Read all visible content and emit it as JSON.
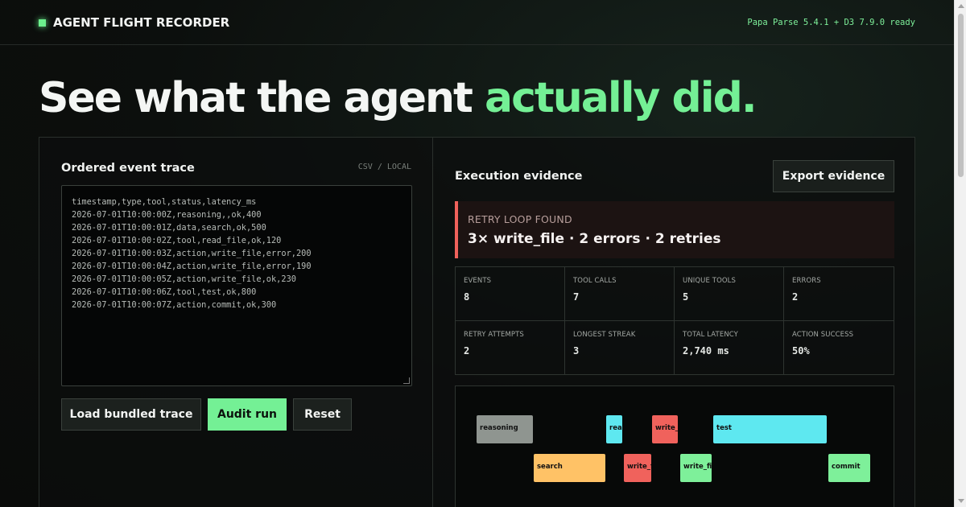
{
  "header": {
    "title": "AGENT FLIGHT RECORDER",
    "status": "Papa Parse 5.4.1 + D3 7.9.0 ready",
    "logo_icon": "square-icon"
  },
  "hero": {
    "lead": "See what the agent ",
    "accent": "actually did."
  },
  "colors": {
    "accent": "#74f095",
    "error": "#f0625c",
    "reasoning": "#8f9590",
    "data": "#ffc266",
    "tool": "#5ee8f0",
    "action": "#7ef09a"
  },
  "trace_panel": {
    "title": "Ordered event trace",
    "tag": "CSV / LOCAL",
    "lines": [
      "timestamp,type,tool,status,latency_ms",
      "2026-07-01T10:00:00Z,reasoning,,ok,400",
      "2026-07-01T10:00:01Z,data,search,ok,500",
      "2026-07-01T10:00:02Z,tool,read_file,ok,120",
      "2026-07-01T10:00:03Z,action,write_file,error,200",
      "2026-07-01T10:00:04Z,action,write_file,error,190",
      "2026-07-01T10:00:05Z,action,write_file,ok,230",
      "2026-07-01T10:00:06Z,tool,test,ok,800",
      "2026-07-01T10:00:07Z,action,commit,ok,300"
    ],
    "buttons": {
      "load": "Load bundled trace",
      "audit": "Audit run",
      "reset": "Reset"
    }
  },
  "evidence_panel": {
    "title": "Execution evidence",
    "export_label": "Export evidence",
    "alert": {
      "label": "RETRY LOOP FOUND",
      "value": "3× write_file · 2 errors · 2 retries"
    },
    "stats": [
      {
        "label": "EVENTS",
        "value": "8"
      },
      {
        "label": "TOOL CALLS",
        "value": "7"
      },
      {
        "label": "UNIQUE TOOLS",
        "value": "5"
      },
      {
        "label": "ERRORS",
        "value": "2"
      },
      {
        "label": "RETRY ATTEMPTS",
        "value": "2"
      },
      {
        "label": "LONGEST STREAK",
        "value": "3"
      },
      {
        "label": "TOTAL LATENCY",
        "value": "2,740 ms"
      },
      {
        "label": "ACTION SUCCESS",
        "value": "50%"
      }
    ],
    "timeline": [
      {
        "label": "reasoning",
        "type": "reasoning"
      },
      {
        "label": "search",
        "type": "data"
      },
      {
        "label": "read_file",
        "type": "tool"
      },
      {
        "label": "write_file",
        "type": "error"
      },
      {
        "label": "write_file",
        "type": "error"
      },
      {
        "label": "write_file",
        "type": "action"
      },
      {
        "label": "test",
        "type": "tool"
      },
      {
        "label": "commit",
        "type": "action"
      }
    ]
  }
}
